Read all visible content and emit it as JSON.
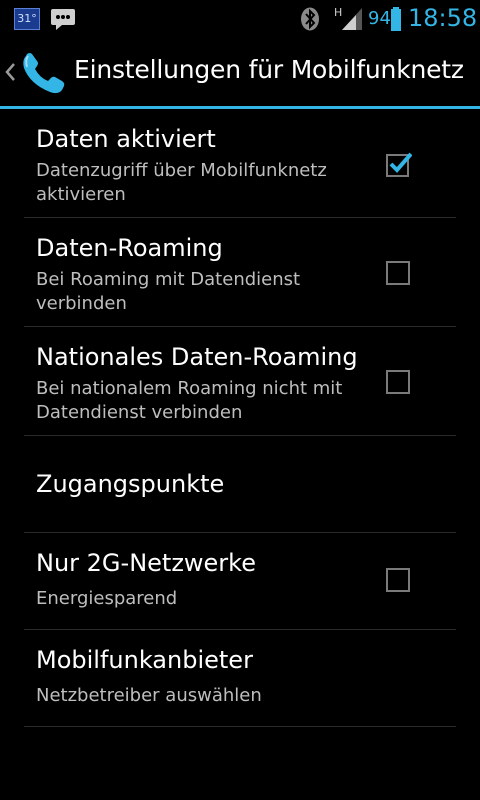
{
  "status_bar": {
    "calendar_day": "31°",
    "battery_level": "94",
    "time": "18:58",
    "network_type": "H",
    "accent_color": "#33b5e5"
  },
  "action_bar": {
    "title": "Einstellungen für Mobilfunknetz",
    "icon": "phone-icon"
  },
  "settings": [
    {
      "title": "Daten aktiviert",
      "summary": "Datenzugriff über Mobilfunknetz aktivieren",
      "checked": true
    },
    {
      "title": "Daten-Roaming",
      "summary": "Bei Roaming mit Datendienst verbinden",
      "checked": false
    },
    {
      "title": "Nationales Daten-Roaming",
      "summary": "Bei nationalem Roaming nicht mit Datendienst verbinden",
      "checked": false
    },
    {
      "title": "Zugangspunkte"
    },
    {
      "title": "Nur 2G-Netzwerke",
      "summary": "Energiesparend",
      "checked": false
    },
    {
      "title": "Mobilfunkanbieter",
      "summary": "Netzbetreiber auswählen"
    }
  ]
}
